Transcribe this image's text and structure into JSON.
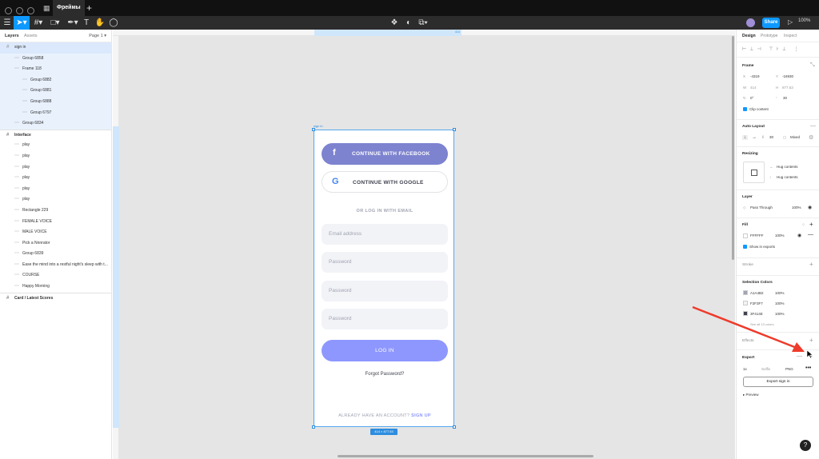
{
  "tabbar": {
    "file_tab": "Фреймы",
    "home_icon": "grid-icon",
    "new_tab": "+"
  },
  "toolbar": {
    "share_label": "Share",
    "zoom_label": "100%"
  },
  "layers_panel": {
    "tabs": [
      "Layers",
      "Assets"
    ],
    "page_selector": "Page 1",
    "rows": [
      {
        "label": "sign in",
        "indent": 0,
        "style": "dark"
      },
      {
        "label": "Group 6858",
        "indent": 1,
        "style": "hl"
      },
      {
        "label": "Frame 118",
        "indent": 1,
        "style": "hl"
      },
      {
        "label": "Group 6882",
        "indent": 2,
        "style": "hl"
      },
      {
        "label": "Group 6881",
        "indent": 2,
        "style": "hl"
      },
      {
        "label": "Group 6888",
        "indent": 2,
        "style": "hl"
      },
      {
        "label": "Group 6797",
        "indent": 2,
        "style": "hl"
      },
      {
        "label": "Group 6834",
        "indent": 1,
        "style": "hl"
      },
      {
        "label": "Interface",
        "indent": 0,
        "style": "bold"
      },
      {
        "label": "play",
        "indent": 1,
        "style": ""
      },
      {
        "label": "play",
        "indent": 1,
        "style": ""
      },
      {
        "label": "play",
        "indent": 1,
        "style": ""
      },
      {
        "label": "play",
        "indent": 1,
        "style": ""
      },
      {
        "label": "play",
        "indent": 1,
        "style": ""
      },
      {
        "label": "play",
        "indent": 1,
        "style": ""
      },
      {
        "label": "Rectangle 229",
        "indent": 1,
        "style": ""
      },
      {
        "label": "FEMALE VOICE",
        "indent": 1,
        "style": ""
      },
      {
        "label": "MALE VOICE",
        "indent": 1,
        "style": ""
      },
      {
        "label": "Pick a Nnnrator",
        "indent": 1,
        "style": ""
      },
      {
        "label": "Group 6839",
        "indent": 1,
        "style": ""
      },
      {
        "label": "Ease the mind into a restful night's sleep with t...",
        "indent": 1,
        "style": ""
      },
      {
        "label": "COURSE",
        "indent": 1,
        "style": ""
      },
      {
        "label": "Happy Morning",
        "indent": 1,
        "style": ""
      },
      {
        "label": "Card / Latest Scores",
        "indent": 0,
        "style": "bold"
      }
    ]
  },
  "ruler": {
    "highlight_label": "414"
  },
  "frame": {
    "name": "sign in",
    "dimensions": "414 × 877.53",
    "facebook_button": "CONTINUE WITH FACEBOOK",
    "google_button": "CONTINUE WITH GOOGLE",
    "divider_text": "OR LOG IN WITH EMAIL",
    "inputs": [
      {
        "placeholder": "Email address"
      },
      {
        "placeholder": "Password"
      },
      {
        "placeholder": "Password"
      },
      {
        "placeholder": "Password"
      }
    ],
    "login_button": "LOG IN",
    "forgot_password": "Forgot Password?",
    "account_prompt": "ALREADY HAVE AN ACCOUNT?",
    "sign_up_link": "SIGN UP",
    "colors": {
      "facebook": "#7d83cf",
      "primary": "#8e97fd",
      "input_bg": "#f2f3f7"
    }
  },
  "properties": {
    "tabs": [
      "Design",
      "Prototype",
      "Inspect"
    ],
    "frame_section": {
      "title": "Frame",
      "x_label": "X",
      "x": "-4319",
      "y_label": "Y",
      "y": "-16930",
      "w_label": "W",
      "w": "414",
      "h_label": "H",
      "h": "877.53",
      "rotation": "0°",
      "radius": "30",
      "clip_content": "Clip content"
    },
    "auto_layout": {
      "title": "Auto Layout",
      "spacing": "30",
      "mode": "Mixed"
    },
    "resizing": {
      "title": "Resizing",
      "width": "Hug contents",
      "height": "Hug contents"
    },
    "layer": {
      "title": "Layer",
      "blend": "Pass Through",
      "opacity": "100%"
    },
    "fill": {
      "title": "Fill",
      "hex": "FFFFFF",
      "opacity": "100%",
      "show_in_exports": "Show in exports"
    },
    "stroke": {
      "title": "Stroke"
    },
    "selection_colors": {
      "title": "Selection Colors",
      "items": [
        {
          "hex": "A1A4B2",
          "opacity": "100%"
        },
        {
          "hex": "F2F3F7",
          "opacity": "100%"
        },
        {
          "hex": "3F414E",
          "opacity": "100%"
        }
      ],
      "see_all": "See all 13 colors"
    },
    "effects": {
      "title": "Effects"
    },
    "export": {
      "title": "Export",
      "scale": "1x",
      "suffix": "Suffix",
      "format": "PNG",
      "export_button": "Export sign in",
      "preview": "Preview"
    }
  }
}
